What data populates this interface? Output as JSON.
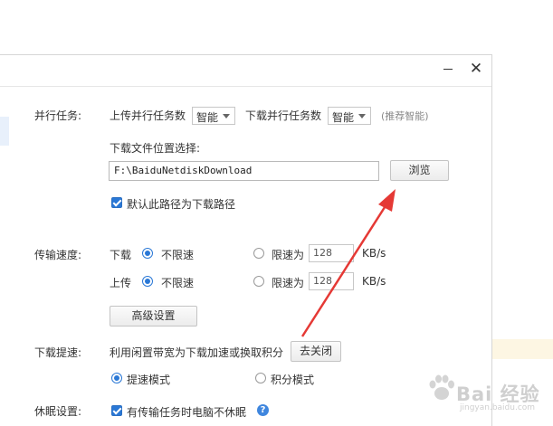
{
  "titlebar": {
    "minimize_glyph": "",
    "close_glyph": "✕"
  },
  "parallel": {
    "label": "并行任务:",
    "upload_label": "上传并行任务数",
    "upload_value": "智能",
    "download_label": "下载并行任务数",
    "download_value": "智能",
    "hint": "(推荐智能)"
  },
  "location": {
    "label": "下载文件位置选择:",
    "path": "F:\\BaiduNetdiskDownload",
    "browse_button": "浏览",
    "default_checkbox_label": "默认此路径为下载路径",
    "default_checked": true
  },
  "speed": {
    "label": "传输速度:",
    "download_label": "下载",
    "upload_label": "上传",
    "unlimited_label": "不限速",
    "limit_label": "限速为",
    "download_limit_value": "128",
    "upload_limit_value": "128",
    "unit": "KB/s",
    "advanced_button": "高级设置"
  },
  "boost": {
    "label": "下载提速:",
    "description": "利用闲置带宽为下载加速或换取积分",
    "close_button": "去关闭",
    "mode_speed_label": "提速模式",
    "mode_points_label": "积分模式"
  },
  "sleep": {
    "label": "休眠设置:",
    "checkbox_label": "有传输任务时电脑不休眠",
    "checked": true,
    "help_glyph": "?"
  },
  "watermark": {
    "text": "Bai 经验",
    "sub": "jingyan.baidu.com"
  },
  "colors": {
    "accent": "#2a78d6",
    "arrow": "#e53935"
  }
}
